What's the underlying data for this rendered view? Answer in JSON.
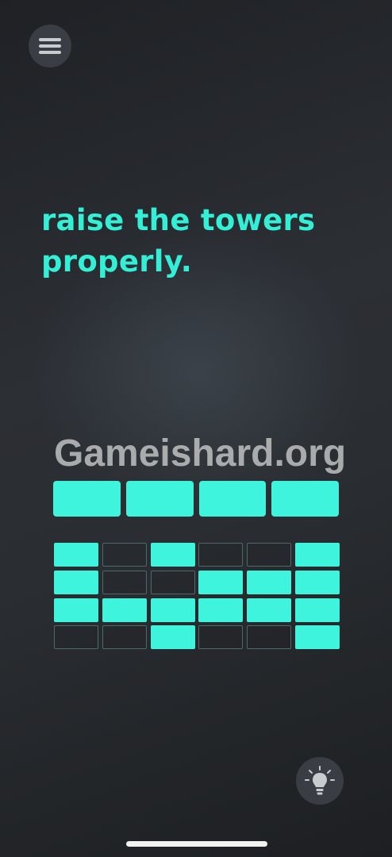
{
  "header": {
    "menu_icon": "hamburger-icon"
  },
  "puzzle": {
    "instruction": "raise the towers properly.",
    "tower_blocks": [
      1,
      1,
      1,
      1
    ],
    "grid": [
      [
        1,
        0,
        1,
        0,
        0,
        1
      ],
      [
        1,
        0,
        0,
        1,
        1,
        1
      ],
      [
        1,
        1,
        1,
        1,
        1,
        1
      ],
      [
        0,
        0,
        1,
        0,
        0,
        1
      ]
    ],
    "accent_color": "#3ef4dc",
    "text_color": "#33efd6"
  },
  "watermark": {
    "text": "Gameishard.org"
  },
  "footer": {
    "hint_icon": "lightbulb-icon"
  }
}
